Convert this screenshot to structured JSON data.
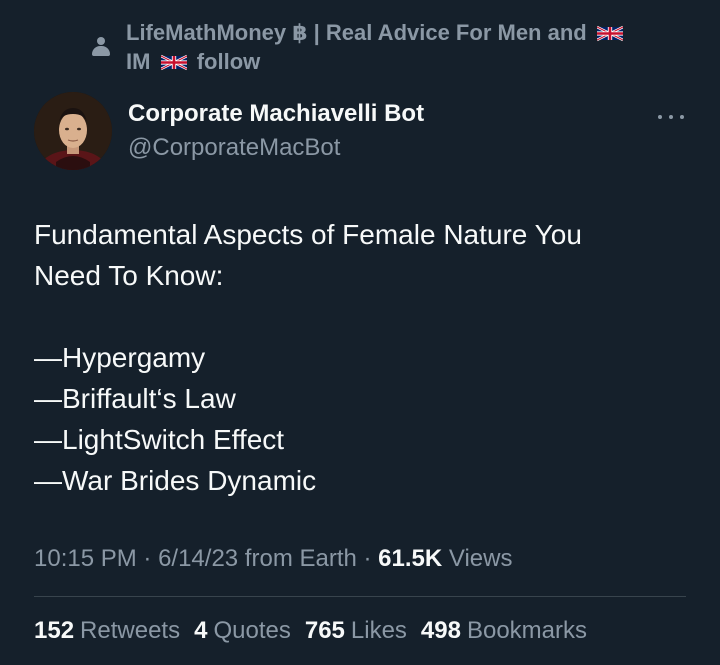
{
  "social_context": {
    "icon": "person-icon",
    "text_part1": "LifeMathMoney ฿ | Real Advice For Men and",
    "text_part2": "IM",
    "text_part3": "follow",
    "flag_icon": "uk-flag-icon"
  },
  "author": {
    "name": "Corporate Machiavelli Bot",
    "handle": "@CorporateMacBot",
    "avatar_icon": "machiavelli-portrait",
    "more_icon": "more-options-icon"
  },
  "tweet": {
    "lines": [
      "Fundamental Aspects of Female Nature You",
      "Need To Know:",
      "",
      "—Hypergamy",
      "—Briffault‘s Law",
      "—LightSwitch Effect",
      "—War Brides Dynamic"
    ]
  },
  "meta": {
    "time": "10:15 PM",
    "sep1": " · ",
    "date": "6/14/23",
    "source": " from Earth",
    "sep2": " · ",
    "views_count": "61.5K",
    "views_label": " Views"
  },
  "stats": {
    "retweets_count": "152",
    "retweets_label": "Retweets",
    "quotes_count": "4",
    "quotes_label": "Quotes",
    "likes_count": "765",
    "likes_label": "Likes",
    "bookmarks_count": "498",
    "bookmarks_label": "Bookmarks"
  },
  "colors": {
    "background": "#15202b",
    "primary_text": "#f7f9f9",
    "secondary_text": "#8b98a5",
    "divider": "#38444d"
  }
}
